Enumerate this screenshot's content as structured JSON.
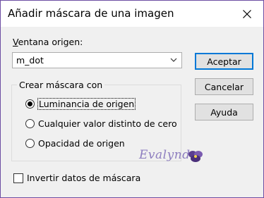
{
  "dialog": {
    "title": "Añadir máscara de una imagen",
    "source_window_label": "Ventana origen:",
    "source_window_value": "m_dot",
    "group_label": "Crear máscara con",
    "options": [
      {
        "label": "Luminancia de origen",
        "selected": true
      },
      {
        "label": "Cualquier valor distinto de cero",
        "selected": false
      },
      {
        "label": "Opacidad de origen",
        "selected": false
      }
    ],
    "invert_label": "Invertir datos de máscara",
    "invert_checked": false
  },
  "buttons": {
    "ok": "Aceptar",
    "cancel": "Cancelar",
    "help": "Ayuda"
  },
  "watermark_text": "Evalynda",
  "icons": {
    "close": "close-icon",
    "dropdown": "chevron-down-icon",
    "watermark": "flower-icon"
  },
  "colors": {
    "window_border": "#6d4ea3",
    "default_button_border": "#0078d7",
    "watermark": "#8d7dbf"
  }
}
